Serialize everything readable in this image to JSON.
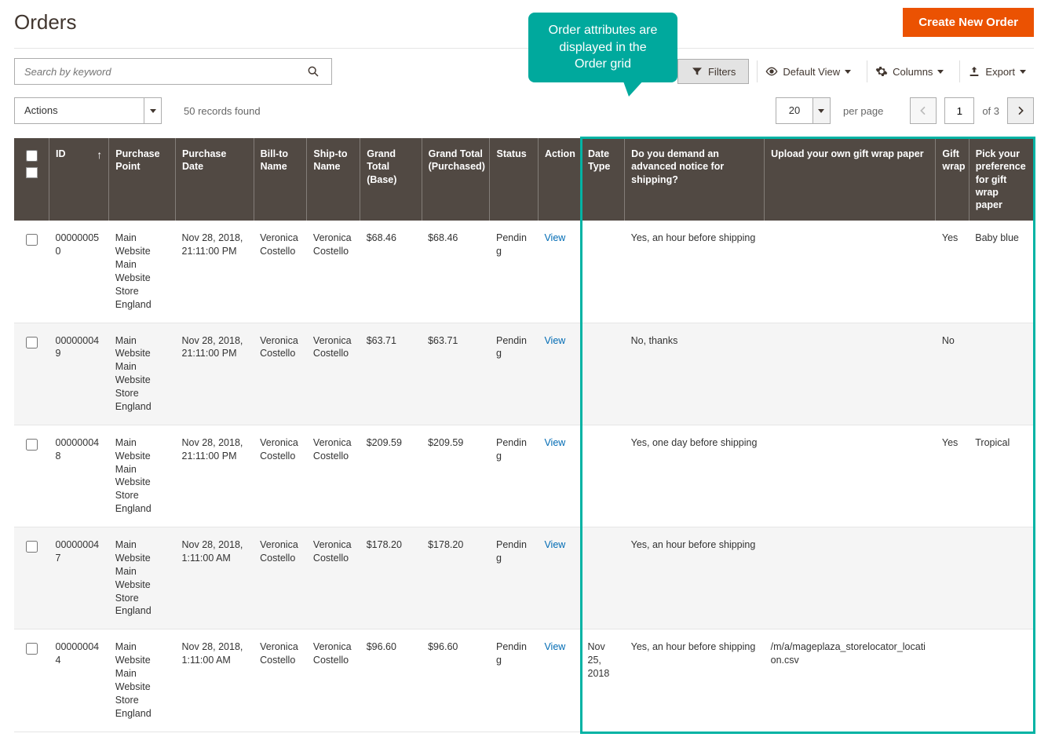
{
  "page": {
    "title": "Orders",
    "create_button": "Create New Order"
  },
  "search": {
    "placeholder": "Search by keyword"
  },
  "callout": "Order attributes are displayed in the Order grid",
  "toolbar": {
    "filters": "Filters",
    "default_view": "Default View",
    "columns": "Columns",
    "export": "Export",
    "actions": "Actions",
    "records_found": "50 records found",
    "per_page_value": "20",
    "per_page_label": "per page",
    "current_page": "1",
    "of_pages": "of 3"
  },
  "columns": {
    "id": "ID",
    "purchase_point": "Purchase Point",
    "purchase_date": "Purchase Date",
    "bill_to": "Bill-to Name",
    "ship_to": "Ship-to Name",
    "gt_base": "Grand Total (Base)",
    "gt_purchased": "Grand Total (Purchased)",
    "status": "Status",
    "action": "Action",
    "date_type": "Date Type",
    "advanced_notice": "Do you demand an advanced notice for shipping?",
    "upload_wrap": "Upload your own gift wrap paper",
    "gift_wrap": "Gift wrap",
    "wrap_pref": "Pick your preference for gift wrap paper"
  },
  "rows": [
    {
      "id": "000000050",
      "purchase_point": "Main Website Main Website Store England",
      "purchase_date": "Nov 28, 2018, 21:11:00 PM",
      "bill_to": "Veronica Costello",
      "ship_to": "Veronica Costello",
      "gt_base": "$68.46",
      "gt_purchased": "$68.46",
      "status": "Pending",
      "action": "View",
      "date_type": "",
      "advanced_notice": "Yes, an hour before shipping",
      "upload_wrap": "",
      "gift_wrap": "Yes",
      "wrap_pref": "Baby blue"
    },
    {
      "id": "000000049",
      "purchase_point": "Main Website Main Website Store England",
      "purchase_date": "Nov 28, 2018, 21:11:00 PM",
      "bill_to": "Veronica Costello",
      "ship_to": "Veronica Costello",
      "gt_base": "$63.71",
      "gt_purchased": "$63.71",
      "status": "Pending",
      "action": "View",
      "date_type": "",
      "advanced_notice": "No, thanks",
      "upload_wrap": "",
      "gift_wrap": "No",
      "wrap_pref": ""
    },
    {
      "id": "000000048",
      "purchase_point": "Main Website Main Website Store England",
      "purchase_date": "Nov 28, 2018, 21:11:00 PM",
      "bill_to": "Veronica Costello",
      "ship_to": "Veronica Costello",
      "gt_base": "$209.59",
      "gt_purchased": "$209.59",
      "status": "Pending",
      "action": "View",
      "date_type": "",
      "advanced_notice": "Yes, one day before shipping",
      "upload_wrap": "",
      "gift_wrap": "Yes",
      "wrap_pref": "Tropical"
    },
    {
      "id": "000000047",
      "purchase_point": "Main Website Main Website Store England",
      "purchase_date": "Nov 28, 2018, 1:11:00 AM",
      "bill_to": "Veronica Costello",
      "ship_to": "Veronica Costello",
      "gt_base": "$178.20",
      "gt_purchased": "$178.20",
      "status": "Pending",
      "action": "View",
      "date_type": "",
      "advanced_notice": "Yes, an hour before shipping",
      "upload_wrap": "",
      "gift_wrap": "",
      "wrap_pref": ""
    },
    {
      "id": "000000044",
      "purchase_point": "Main Website Main Website Store England",
      "purchase_date": "Nov 28, 2018, 1:11:00 AM",
      "bill_to": "Veronica Costello",
      "ship_to": "Veronica Costello",
      "gt_base": "$96.60",
      "gt_purchased": "$96.60",
      "status": "Pending",
      "action": "View",
      "date_type": "Nov 25, 2018",
      "advanced_notice": "Yes, an hour before shipping",
      "upload_wrap": "/m/a/mageplaza_storelocator_location.csv",
      "gift_wrap": "",
      "wrap_pref": ""
    }
  ]
}
